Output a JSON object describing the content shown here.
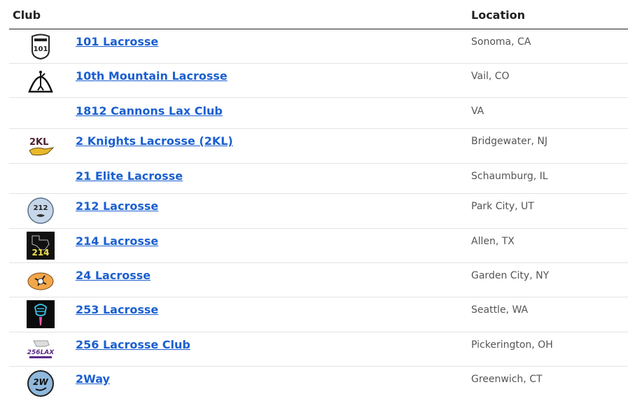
{
  "table": {
    "headers": {
      "club": "Club",
      "location": "Location"
    },
    "rows": [
      {
        "name": "101 Lacrosse",
        "location": "Sonoma, CA",
        "logo": "route-101-shield-icon",
        "logo_text": "101"
      },
      {
        "name": "10th Mountain Lacrosse",
        "location": "Vail, CO",
        "logo": "mountain-player-icon",
        "logo_text": ""
      },
      {
        "name": "1812 Cannons Lax Club",
        "location": "VA",
        "logo": "",
        "logo_text": ""
      },
      {
        "name": "2 Knights Lacrosse (2KL)",
        "location": "Bridgewater, NJ",
        "logo": "2kl-logo-icon",
        "logo_text": "2KL"
      },
      {
        "name": "21 Elite Lacrosse",
        "location": "Schaumburg, IL",
        "logo": "",
        "logo_text": ""
      },
      {
        "name": "212 Lacrosse",
        "location": "Park City, UT",
        "logo": "212-badge-icon",
        "logo_text": "212"
      },
      {
        "name": "214 Lacrosse",
        "location": "Allen, TX",
        "logo": "214-texas-icon",
        "logo_text": "214"
      },
      {
        "name": "24 Lacrosse",
        "location": "Garden City, NY",
        "logo": "24-lacrosse-logo-icon",
        "logo_text": ""
      },
      {
        "name": "253 Lacrosse",
        "location": "Seattle, WA",
        "logo": "253-lacrosse-head-icon",
        "logo_text": ""
      },
      {
        "name": "256 Lacrosse Club",
        "location": "Pickerington, OH",
        "logo": "256lax-logo-icon",
        "logo_text": "256LAX"
      },
      {
        "name": "2Way",
        "location": "Greenwich, CT",
        "logo": "2w-badge-icon",
        "logo_text": "2W"
      }
    ]
  },
  "colors": {
    "link": "#1a5fd0",
    "location": "#555555",
    "header": "#222222",
    "divider": "#e3e3e3"
  }
}
